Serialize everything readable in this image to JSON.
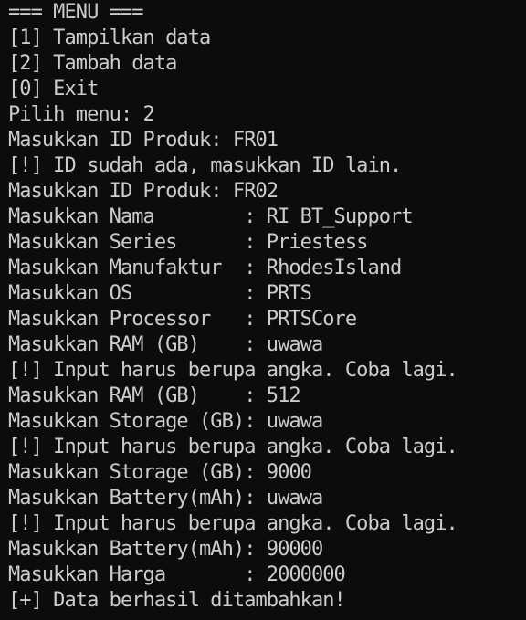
{
  "terminal": {
    "lines": [
      "=== MENU ===",
      "[1] Tampilkan data",
      "[2] Tambah data",
      "[0] Exit",
      "Pilih menu: 2",
      "Masukkan ID Produk: FR01",
      "[!] ID sudah ada, masukkan ID lain.",
      "Masukkan ID Produk: FR02",
      "Masukkan Nama        : RI BT_Support",
      "Masukkan Series      : Priestess",
      "Masukkan Manufaktur  : RhodesIsland",
      "Masukkan OS          : PRTS",
      "Masukkan Processor   : PRTSCore",
      "Masukkan RAM (GB)    : uwawa",
      "[!] Input harus berupa angka. Coba lagi.",
      "Masukkan RAM (GB)    : 512",
      "Masukkan Storage (GB): uwawa",
      "[!] Input harus berupa angka. Coba lagi.",
      "Masukkan Storage (GB): 9000",
      "Masukkan Battery(mAh): uwawa",
      "[!] Input harus berupa angka. Coba lagi.",
      "Masukkan Battery(mAh): 90000",
      "Masukkan Harga       : 2000000",
      "[+] Data berhasil ditambahkan!"
    ]
  },
  "colors": {
    "background": "#0c0c0c",
    "foreground": "#cccccc"
  }
}
